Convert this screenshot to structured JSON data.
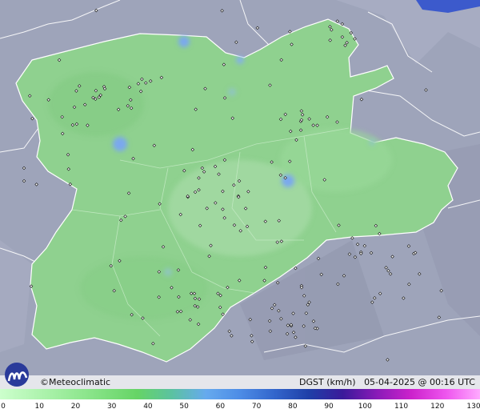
{
  "map": {
    "logo": "meteoclimatic-logo-icon",
    "credit": "©Meteoclimatic",
    "variable": "DGST (km/h)",
    "timestamp": "05-04-2025 @ 00:16 UTC"
  },
  "legend": {
    "ticks": [
      0,
      10,
      20,
      30,
      40,
      50,
      60,
      70,
      80,
      90,
      100,
      110,
      120,
      130
    ],
    "colors": [
      "#ccffcc",
      "#b3f5b3",
      "#99eb99",
      "#80e080",
      "#66d466",
      "#5bc2a0",
      "#66aaee",
      "#4d8ce6",
      "#3366cc",
      "#1f3fa8",
      "#3a1a9a",
      "#8a1ab8",
      "#cc22cc",
      "#ee55ee",
      "#ffaaff"
    ]
  },
  "colors": {
    "background": "#9aa0b6",
    "region_fill": "#8fd18f",
    "border": "#ffffff",
    "station": "#222222"
  }
}
